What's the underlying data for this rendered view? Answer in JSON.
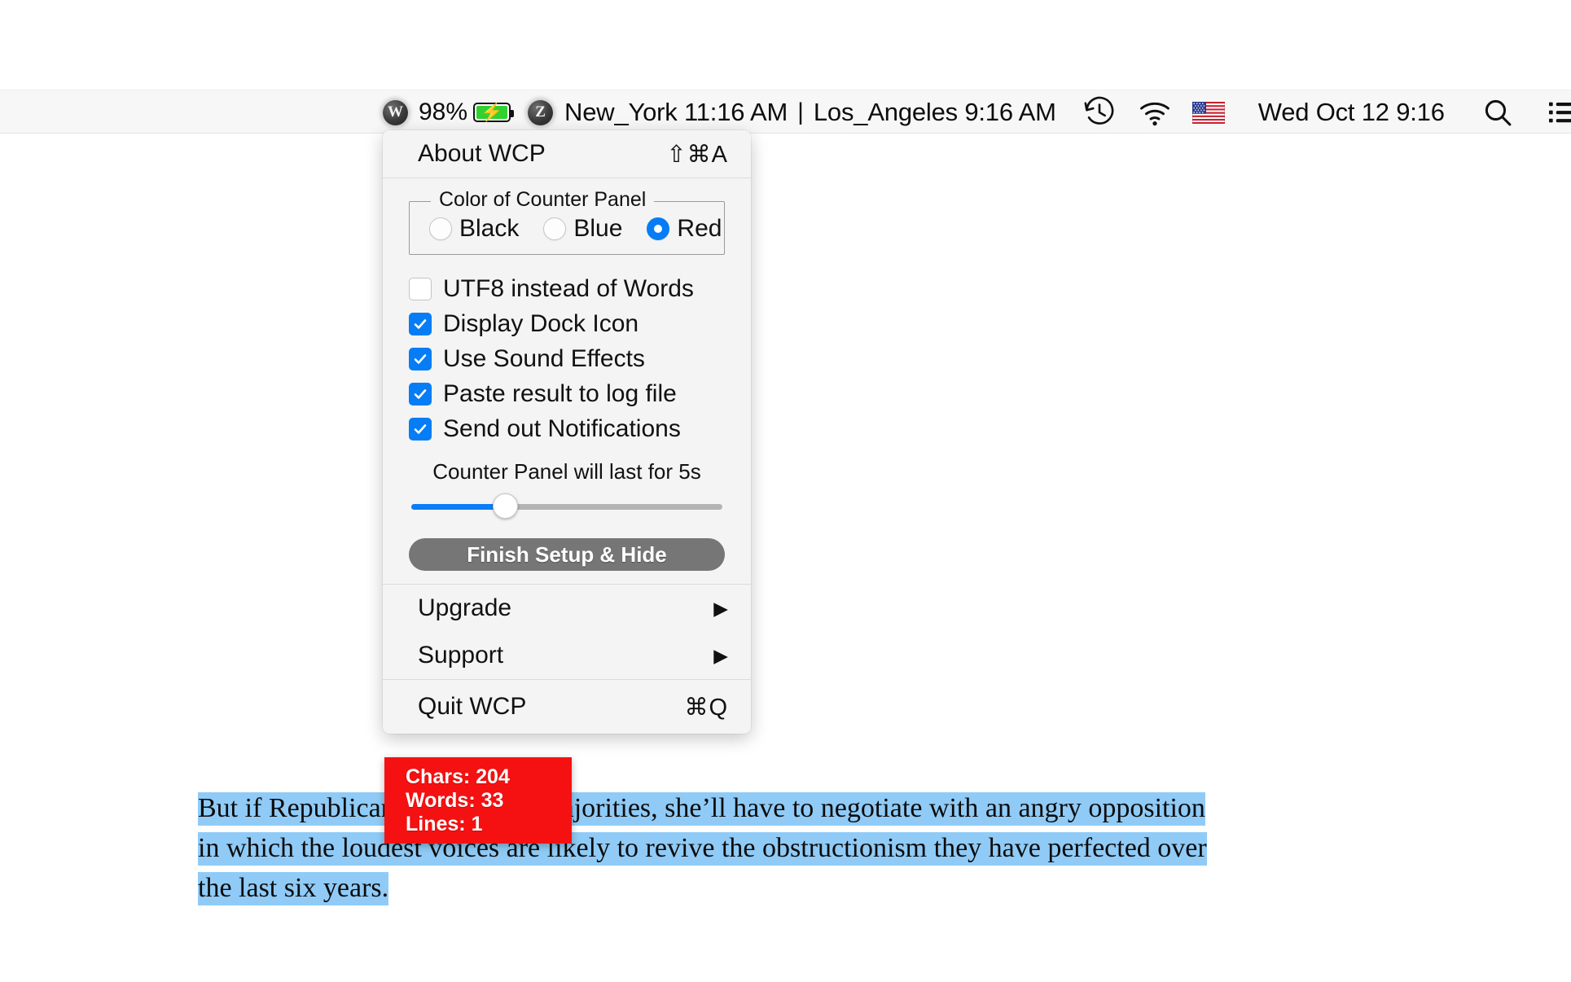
{
  "menubar": {
    "app_icon_letter": "W",
    "battery_percent": "98%",
    "battery_state_icon": "battery-charging-icon",
    "timezone_icon_letter": "Z",
    "timezones": "New_York 11:16 AM  |  Los_Angeles 9:16 AM",
    "timezone_primary": "New_York 11:16 AM",
    "timezone_separator": "|",
    "timezone_secondary": "Los_Angeles 9:16 AM",
    "history_icon": "clock-rewind-icon",
    "wifi_icon": "wifi-icon",
    "flag_icon": "us-flag-icon",
    "clock": "Wed Oct 12  9:16",
    "search_icon": "search-icon",
    "control_center_icon": "list-menu-icon"
  },
  "menu": {
    "about": {
      "label": "About WCP",
      "shortcut": "⇧⌘A"
    },
    "groupbox": {
      "legend": "Color of Counter Panel",
      "options": [
        {
          "label": "Black",
          "selected": false
        },
        {
          "label": "Blue",
          "selected": false
        },
        {
          "label": "Red",
          "selected": true
        }
      ]
    },
    "checkboxes": [
      {
        "label": "UTF8 instead of Words",
        "checked": false
      },
      {
        "label": "Display Dock Icon",
        "checked": true
      },
      {
        "label": "Use Sound Effects",
        "checked": true
      },
      {
        "label": "Paste result to log file",
        "checked": true
      },
      {
        "label": "Send out Notifications",
        "checked": true
      }
    ],
    "slider": {
      "caption": "Counter Panel will last for 5s",
      "value_percent": 30,
      "seconds": "5s"
    },
    "finish_button": "Finish Setup & Hide",
    "items": [
      {
        "label": "Upgrade",
        "submenu": true,
        "arrow": "▶"
      },
      {
        "label": "Support",
        "submenu": true,
        "arrow": "▶"
      }
    ],
    "quit": {
      "label": "Quit WCP",
      "shortcut": "⌘Q"
    }
  },
  "counter_panel": {
    "color": "#f51111",
    "chars": "Chars: 204",
    "words": "Words: 33",
    "lines": "Lines: 1"
  },
  "document": {
    "line1_a": "But if Republicans retain their majorities, she’ll have to negotiate with an angry opposition",
    "line2": "in which the loudest voices are likely to revive the obstructionism they have perfected over",
    "line3": "the last six years.",
    "selection_color": "#8fcbf6"
  },
  "colors": {
    "accent_blue": "#067cf5",
    "menubar_bg": "#f7f7f7",
    "menu_bg": "#f4f4f4",
    "counter_red": "#f51111",
    "selection_blue": "#8fcbf6",
    "button_gray": "#767676"
  }
}
